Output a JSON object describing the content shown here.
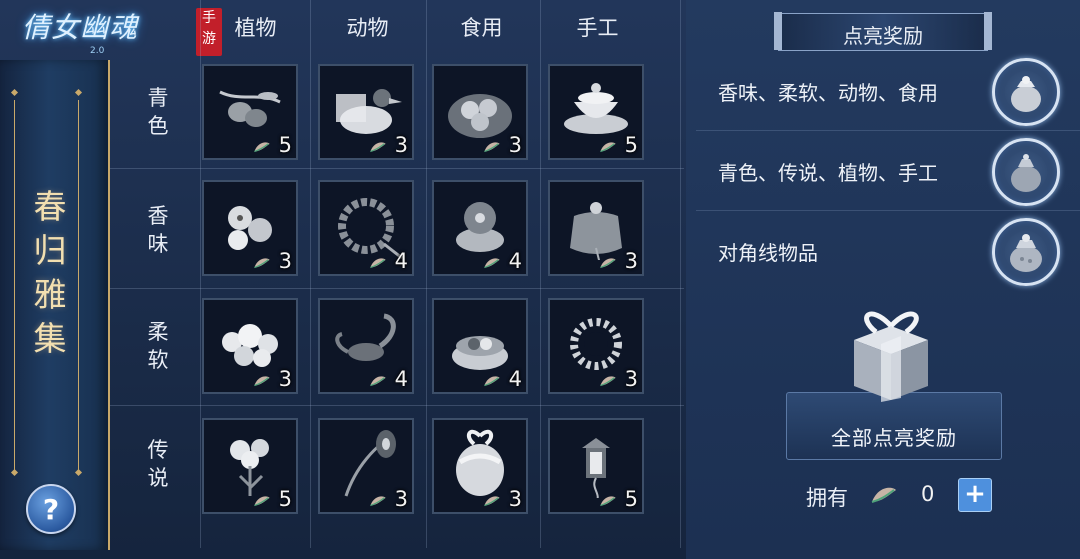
{
  "logo": {
    "title": "倩女幽魂",
    "edition": "手游",
    "sub": "2.0"
  },
  "event": {
    "title_chars": [
      "春",
      "归",
      "雅",
      "集"
    ],
    "help_label": "?"
  },
  "columns": [
    "植物",
    "动物",
    "食用",
    "手工"
  ],
  "rows": [
    {
      "label": "青色",
      "chars": [
        "青",
        "色"
      ]
    },
    {
      "label": "香味",
      "chars": [
        "香",
        "味"
      ]
    },
    {
      "label": "柔软",
      "chars": [
        "柔",
        "软"
      ]
    },
    {
      "label": "传说",
      "chars": [
        "传",
        "说"
      ]
    }
  ],
  "grid_items": [
    [
      {
        "name": "olives-branch",
        "count": "5"
      },
      {
        "name": "duck",
        "count": "3"
      },
      {
        "name": "eggs-plate",
        "count": "3"
      },
      {
        "name": "tea-cups",
        "count": "5"
      }
    ],
    [
      {
        "name": "flower-blossom",
        "count": "3"
      },
      {
        "name": "prayer-beads",
        "count": "4"
      },
      {
        "name": "flower-cake",
        "count": "4"
      },
      {
        "name": "sachet",
        "count": "3"
      }
    ],
    [
      {
        "name": "white-flowers",
        "count": "3"
      },
      {
        "name": "scorpion",
        "count": "4"
      },
      {
        "name": "dumpling-basket",
        "count": "4"
      },
      {
        "name": "flower-wreath",
        "count": "3"
      }
    ],
    [
      {
        "name": "flower-bush",
        "count": "5"
      },
      {
        "name": "peacock-feather",
        "count": "3"
      },
      {
        "name": "gift-egg",
        "count": "3"
      },
      {
        "name": "lantern",
        "count": "5"
      }
    ]
  ],
  "rewards": {
    "tab_label": "点亮奖励",
    "items": [
      {
        "label": "香味、柔软、动物、食用",
        "icon": "pouch-icon"
      },
      {
        "label": "青色、传说、植物、手工",
        "icon": "pouch-icon"
      },
      {
        "label": "对角线物品",
        "icon": "pouch-icon"
      }
    ],
    "claim_all_label": "全部点亮奖励"
  },
  "owned": {
    "label": "拥有",
    "value": "0",
    "add_label": "+"
  },
  "colors": {
    "accent": "#4e90dd",
    "gold": "#c9a96a",
    "cell_bg": "#0d1526"
  }
}
